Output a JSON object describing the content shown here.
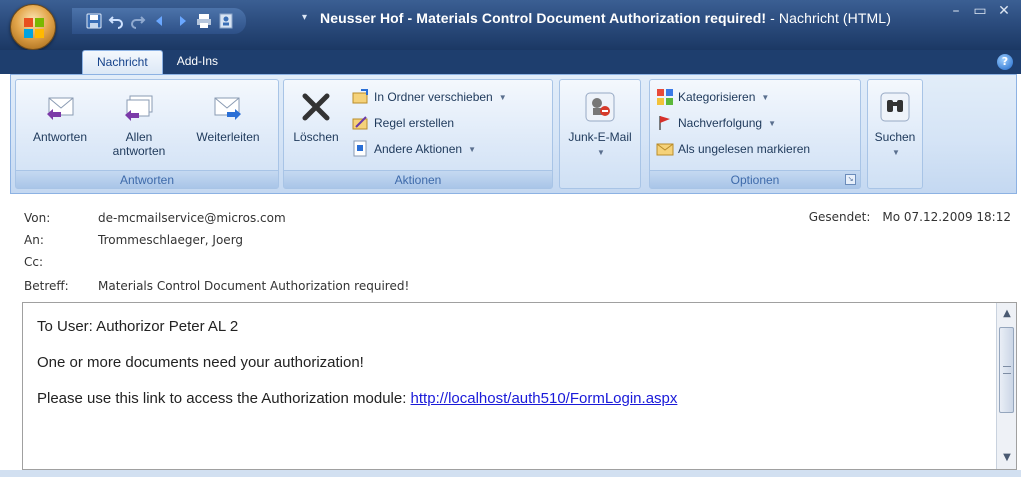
{
  "window": {
    "title_main": "Neusser Hof - Materials Control Document Authorization required!",
    "title_suffix": " - Nachricht (HTML)",
    "controls": [
      "minimize-icon",
      "maximize-icon",
      "close-icon"
    ]
  },
  "tabs": [
    {
      "label": "Nachricht"
    },
    {
      "label": "Add-Ins"
    }
  ],
  "ribbon": {
    "groups": {
      "antworten": {
        "label": "Antworten",
        "buttons": [
          {
            "label": "Antworten"
          },
          {
            "label": "Allen antworten"
          },
          {
            "label": "Weiterleiten"
          }
        ]
      },
      "aktionen": {
        "label": "Aktionen",
        "delete_label": "Löschen",
        "move_label": "In Ordner verschieben",
        "rule_label": "Regel erstellen",
        "other_label": "Andere Aktionen"
      },
      "junk": {
        "label": "Junk-E-Mail"
      },
      "optionen": {
        "label": "Optionen",
        "categorize_label": "Kategorisieren",
        "followup_label": "Nachverfolgung",
        "unread_label": "Als ungelesen markieren"
      },
      "suchen": {
        "label": "Suchen"
      }
    }
  },
  "header": {
    "from_label": "Von:",
    "from_value": "de-mcmailservice@micros.com",
    "to_label": "An:",
    "to_value": "Trommeschlaeger, Joerg",
    "cc_label": "Cc:",
    "cc_value": "",
    "subject_label": "Betreff:",
    "subject_value": "Materials Control Document Authorization required!",
    "sent_label": "Gesendet:",
    "sent_value": "Mo 07.12.2009 18:12"
  },
  "body": {
    "line1": "To User: Authorizor Peter AL 2",
    "line2": "One or more documents need your authorization!",
    "line3_prefix": "Please use this link to access the Authorization module: ",
    "link": "http://localhost/auth510/FormLogin.aspx"
  },
  "colors": {
    "title_bar": "#2d4e80",
    "ribbon": "#d5e4f6",
    "link": "#1a1ad9"
  }
}
